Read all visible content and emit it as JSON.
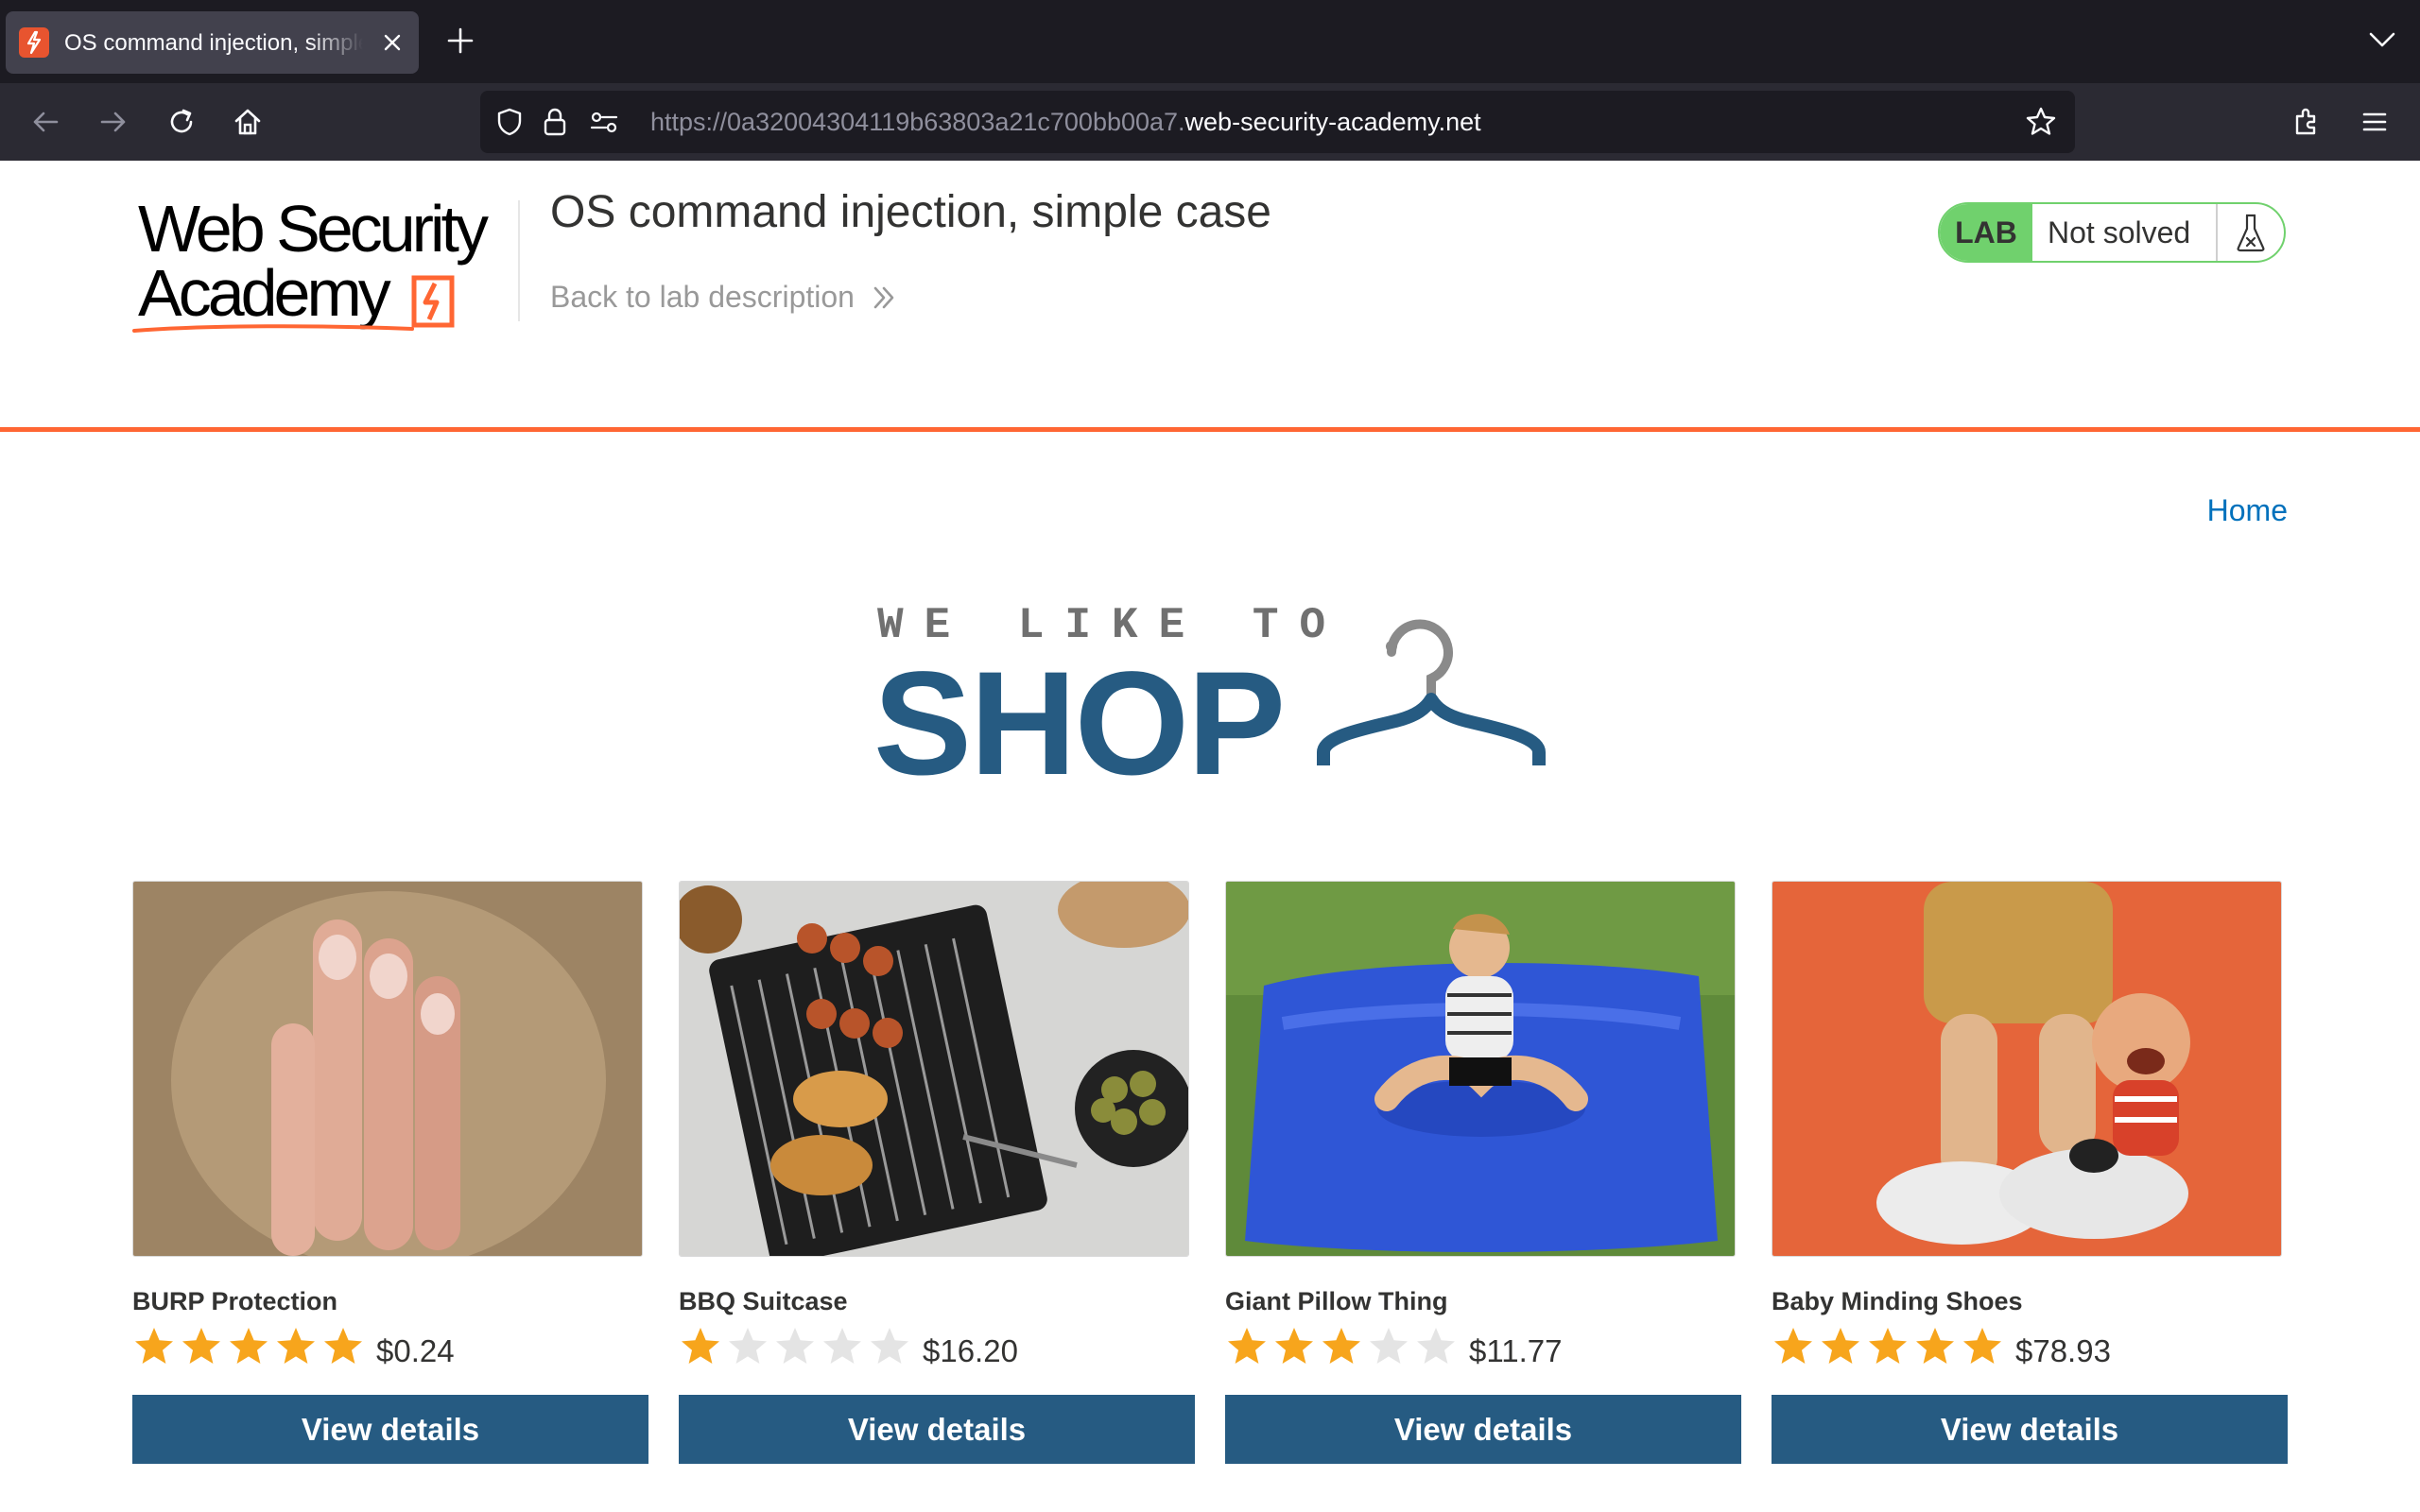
{
  "browser": {
    "tab_title": "OS command injection, simple case",
    "url_prefix": "https://0a32004304119b63803a21c700bb00a7.",
    "url_host": "web-security-academy.net"
  },
  "header": {
    "logo_line1": "Web Security",
    "logo_line2": "Academy",
    "lab_title": "OS command injection, simple case",
    "back_link": "Back to lab description",
    "status_badge": "LAB",
    "status_text": "Not solved"
  },
  "nav": {
    "home": "Home"
  },
  "banner": {
    "tagline": "WE LIKE TO",
    "word": "SHOP"
  },
  "products": [
    {
      "name": "BURP Protection",
      "rating": 5,
      "price": "$0.24",
      "button": "View details"
    },
    {
      "name": "BBQ Suitcase",
      "rating": 1,
      "price": "$16.20",
      "button": "View details"
    },
    {
      "name": "Giant Pillow Thing",
      "rating": 3,
      "price": "$11.77",
      "button": "View details"
    },
    {
      "name": "Baby Minding Shoes",
      "rating": 5,
      "price": "$78.93",
      "button": "View details"
    }
  ],
  "colors": {
    "accent": "#ff6633",
    "brand_blue": "#265b82",
    "link": "#0071bc",
    "lab_green": "#70d16d",
    "star_on": "#f7a51c",
    "star_off": "#e4e4e4"
  }
}
